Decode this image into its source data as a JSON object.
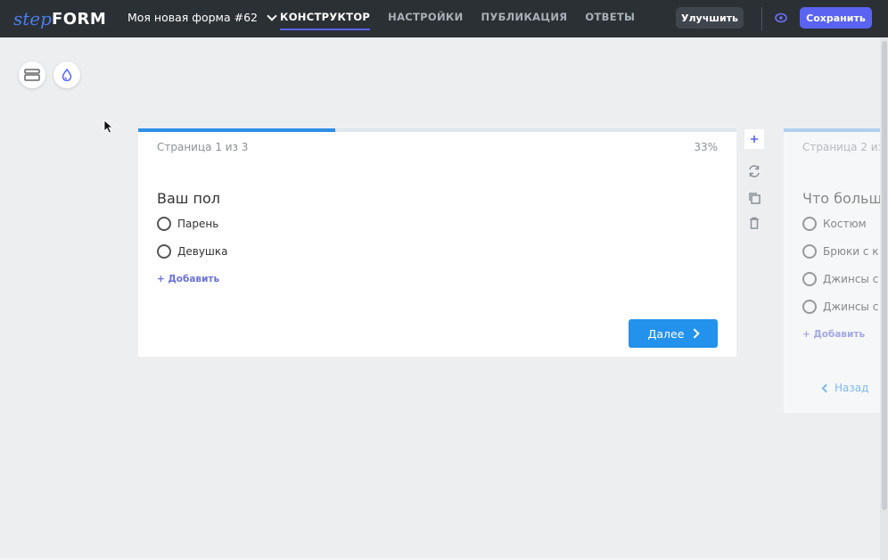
{
  "header": {
    "logo_step": "step",
    "logo_form": "FORM",
    "form_title": "Моя новая форма #62",
    "nav": [
      {
        "label": "КОНСТРУКТОР",
        "active": true
      },
      {
        "label": "НАСТРОЙКИ",
        "active": false
      },
      {
        "label": "ПУБЛИКАЦИЯ",
        "active": false
      },
      {
        "label": "ОТВЕТЫ",
        "active": false
      }
    ],
    "improve_label": "Улучшить",
    "save_label": "Сохранить"
  },
  "page1": {
    "page_label": "Страница 1 из 3",
    "percent_label": "33%",
    "progress": 0.33,
    "question": "Ваш пол",
    "options": [
      "Парень",
      "Девушка"
    ],
    "add_label": "+ Добавить",
    "next_label": "Далее"
  },
  "page2": {
    "page_label": "Страница 2 из",
    "question": "Что больше",
    "options": [
      "Костюм",
      "Брюки с к",
      "Джинсы с",
      "Джинсы с"
    ],
    "add_label": "+ Добавить",
    "back_label": "Назад"
  },
  "colors": {
    "topbar": "#2b3035",
    "accent": "#5a63f2",
    "primary_button": "#2392ec",
    "progress_fill": "#2d8fe8"
  },
  "icons": [
    "logo",
    "chevron-down-icon",
    "eye-icon",
    "layout-icon",
    "droplet-icon",
    "plus-icon",
    "refresh-icon",
    "copy-icon",
    "trash-icon",
    "chevron-right-icon",
    "chevron-left-icon",
    "cursor-icon"
  ]
}
